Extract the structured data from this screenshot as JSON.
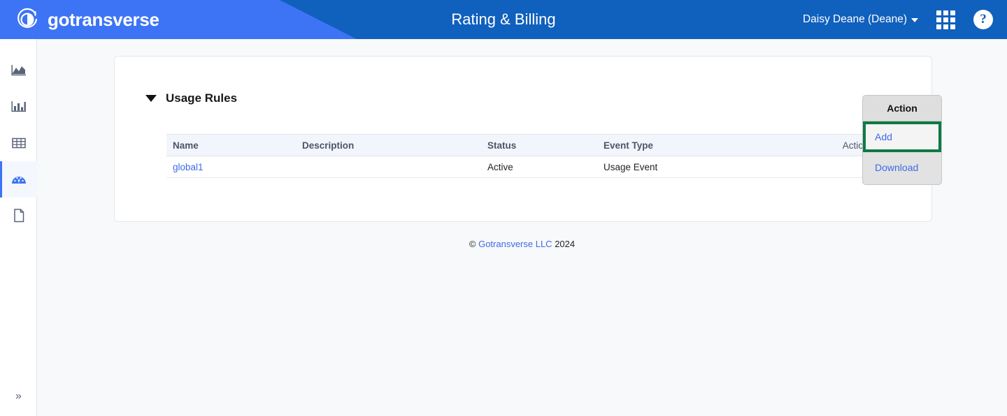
{
  "header": {
    "brand_name": "gotransverse",
    "brand_logo_icon": "gotransverse-circle-logo-icon",
    "title": "Rating & Billing",
    "user_menu_label": "Daisy Deane (Deane)",
    "apps_icon": "grid-apps-icon",
    "help_icon": "question-mark-help-icon",
    "bg_color_left": "#3d74f5",
    "bg_color_right": "#1060bd"
  },
  "sidebar": {
    "items": [
      {
        "icon": "area-chart-icon",
        "name": "sidebar-item-area-chart",
        "active": false
      },
      {
        "icon": "bar-chart-icon",
        "name": "sidebar-item-bar-chart",
        "active": false
      },
      {
        "icon": "table-grid-icon",
        "name": "sidebar-item-table",
        "active": false
      },
      {
        "icon": "speedometer-gauge-icon",
        "name": "sidebar-item-usage",
        "active": true
      },
      {
        "icon": "document-page-icon",
        "name": "sidebar-item-document",
        "active": false
      }
    ],
    "expand_label": "»",
    "active_accent": "#3d74f5"
  },
  "main": {
    "section_title": "Usage Rules",
    "collapse_toggle_icon": "triangle-down-icon",
    "table": {
      "columns": [
        "Name",
        "Description",
        "Status",
        "Event Type",
        "Actions"
      ],
      "rows": [
        {
          "name": "global1",
          "description": "",
          "status": "Active",
          "event_type": "Usage Event",
          "actions": ""
        }
      ]
    },
    "action_menu": {
      "button_label": "Action",
      "items": [
        {
          "label": "Add",
          "selected": true
        },
        {
          "label": "Download",
          "selected": false
        }
      ],
      "highlight_color": "#0d7a44"
    }
  },
  "footer": {
    "symbol": "©",
    "link_text": "Gotransverse LLC",
    "year": "2024"
  }
}
